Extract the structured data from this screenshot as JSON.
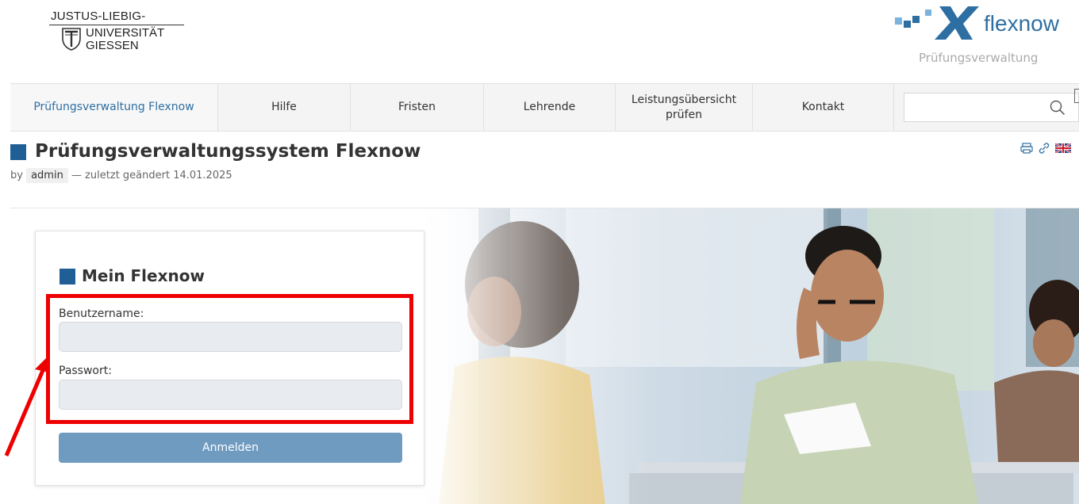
{
  "header": {
    "uni_logo": {
      "line1": "JUSTUS-LIEBIG-",
      "line2": "UNIVERSITÄT",
      "line3": "GIESSEN"
    },
    "flexnow_logo": {
      "word": "flexnow",
      "subtitle": "Prüfungsverwaltung",
      "accent": "#2e6fa3"
    }
  },
  "nav": {
    "items": [
      {
        "label": "Prüfungsverwaltung Flexnow",
        "active": true
      },
      {
        "label": "Hilfe"
      },
      {
        "label": "Fristen"
      },
      {
        "label": "Lehrende"
      },
      {
        "label": "Leistungsübersicht prüfen"
      },
      {
        "label": "Kontakt"
      }
    ],
    "search": {
      "placeholder": "",
      "icon": "search-icon"
    }
  },
  "page": {
    "title": "Prüfungsverwaltungssystem Flexnow",
    "by_prefix": "by",
    "author": "admin",
    "modified": "— zuletzt geändert 14.01.2025",
    "actions": [
      "print-icon",
      "link-icon",
      "uk-flag-icon"
    ]
  },
  "login": {
    "title": "Mein Flexnow",
    "username_label": "Benutzername:",
    "username_value": "",
    "password_label": "Passwort:",
    "password_value": "",
    "submit_label": "Anmelden"
  },
  "colors": {
    "brand_blue": "#1f5f96",
    "button": "#6f9bc1",
    "annotation_red": "#ee0000"
  }
}
